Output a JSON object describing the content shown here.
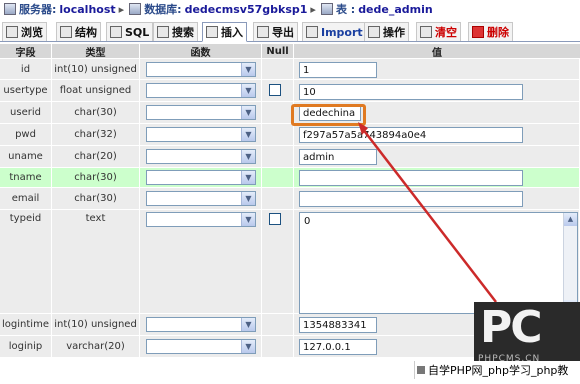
{
  "breadcrumb": {
    "server_label": "服务器:",
    "server_value": "localhost",
    "db_label": "数据库:",
    "db_value": "dedecmsv57gbksp1",
    "table_label": "表 :",
    "table_value": "dede_admin"
  },
  "tabs": [
    {
      "label": "浏览"
    },
    {
      "label": "结构"
    },
    {
      "label": "SQL"
    },
    {
      "label": "搜索"
    },
    {
      "label": "插入"
    },
    {
      "label": "导出"
    },
    {
      "label": "Import"
    },
    {
      "label": "操作"
    },
    {
      "label": "清空"
    },
    {
      "label": "删除"
    }
  ],
  "columns": {
    "field": "字段",
    "type": "类型",
    "function": "函数",
    "null": "Null",
    "value": "值"
  },
  "rows": [
    {
      "name": "id",
      "type": "int(10) unsigned",
      "value": "1"
    },
    {
      "name": "usertype",
      "type": "float unsigned",
      "value": "10"
    },
    {
      "name": "userid",
      "type": "char(30)",
      "value": "dedechina"
    },
    {
      "name": "pwd",
      "type": "char(32)",
      "value": "f297a57a5a743894a0e4"
    },
    {
      "name": "uname",
      "type": "char(20)",
      "value": "admin"
    },
    {
      "name": "tname",
      "type": "char(30)",
      "value": ""
    },
    {
      "name": "email",
      "type": "char(30)",
      "value": ""
    },
    {
      "name": "typeid",
      "type": "text",
      "value": "0"
    },
    {
      "name": "logintime",
      "type": "int(10) unsigned",
      "value": "1354883341"
    },
    {
      "name": "loginip",
      "type": "varchar(20)",
      "value": "127.0.0.1"
    }
  ],
  "watermark": {
    "logo_text": "PC",
    "logo_sub": "PHPCMS.CN",
    "footer_text": "自学PHP网_php学习_php教"
  },
  "colors": {
    "highlight_row": "#ccffcc",
    "annotation_box": "#e07a22",
    "annotation_arrow": "#cc2a2a"
  }
}
